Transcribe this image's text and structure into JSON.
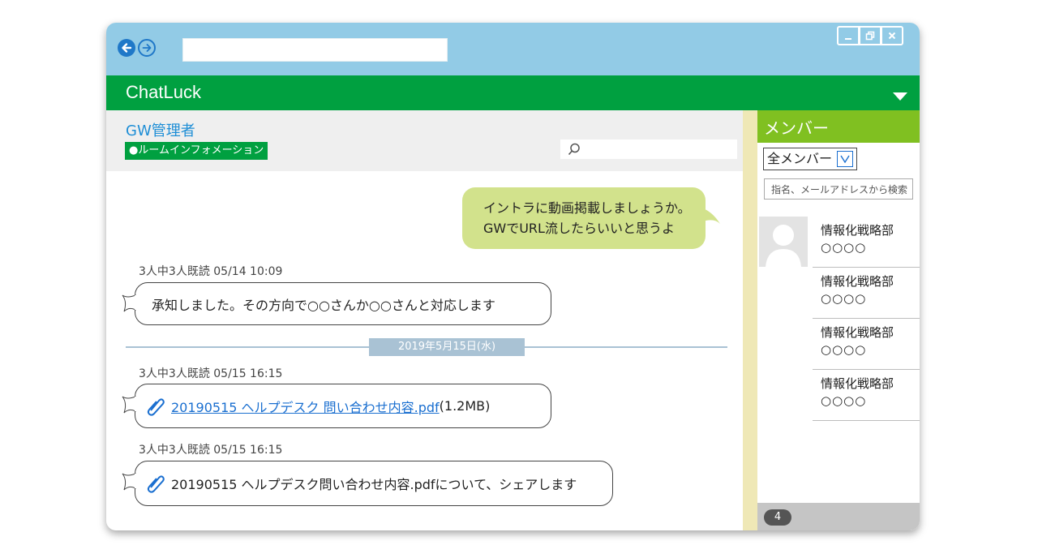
{
  "app": {
    "title": "ChatLuck"
  },
  "room": {
    "name": "GW管理者",
    "info_label": "●ルームインフォメーション",
    "search_placeholder": ""
  },
  "messages": {
    "own": {
      "line1": "イントラに動画掲載しましょうか。",
      "line2": "GWでURL流したらいいと思うよ"
    },
    "m1": {
      "read": "3人中3人既読 05/14 10:09",
      "text": "承知しました。その方向で○○さんか○○さんと対応します"
    },
    "date_separator": "2019年5月15日(水)",
    "m2": {
      "read": "3人中3人既読 05/15 16:15",
      "link_text": "20190515 ヘルプデスク 問い合わせ内容.pdf",
      "size": "(1.2MB)"
    },
    "m3": {
      "read": "3人中3人既読 05/15 16:15",
      "text": "20190515 ヘルプデスク問い合わせ内容.pdfについて、シェアします"
    }
  },
  "members": {
    "title": "メンバー",
    "filter_selected": "全メンバー",
    "search_placeholder": "指名、メールアドレスから検索",
    "list": [
      {
        "dept": "情報化戦略部",
        "name": "○○○○"
      },
      {
        "dept": "情報化戦略部",
        "name": "○○○○"
      },
      {
        "dept": "情報化戦略部",
        "name": "○○○○"
      },
      {
        "dept": "情報化戦略部",
        "name": "○○○○"
      }
    ],
    "count": "4"
  },
  "icons": [
    "back-arrow-icon",
    "forward-arrow-icon",
    "minimize-icon",
    "maximize-icon",
    "close-icon",
    "dropdown-triangle-icon",
    "search-icon",
    "paperclip-icon",
    "avatar-icon",
    "chevron-down-icon"
  ],
  "colors": {
    "titlebar": "#92cbe6",
    "appbar": "#00a040",
    "members_header": "#80c021",
    "own_bubble": "#d2e28c",
    "link": "#1a6fd0",
    "accent_blue": "#1f78c8"
  }
}
